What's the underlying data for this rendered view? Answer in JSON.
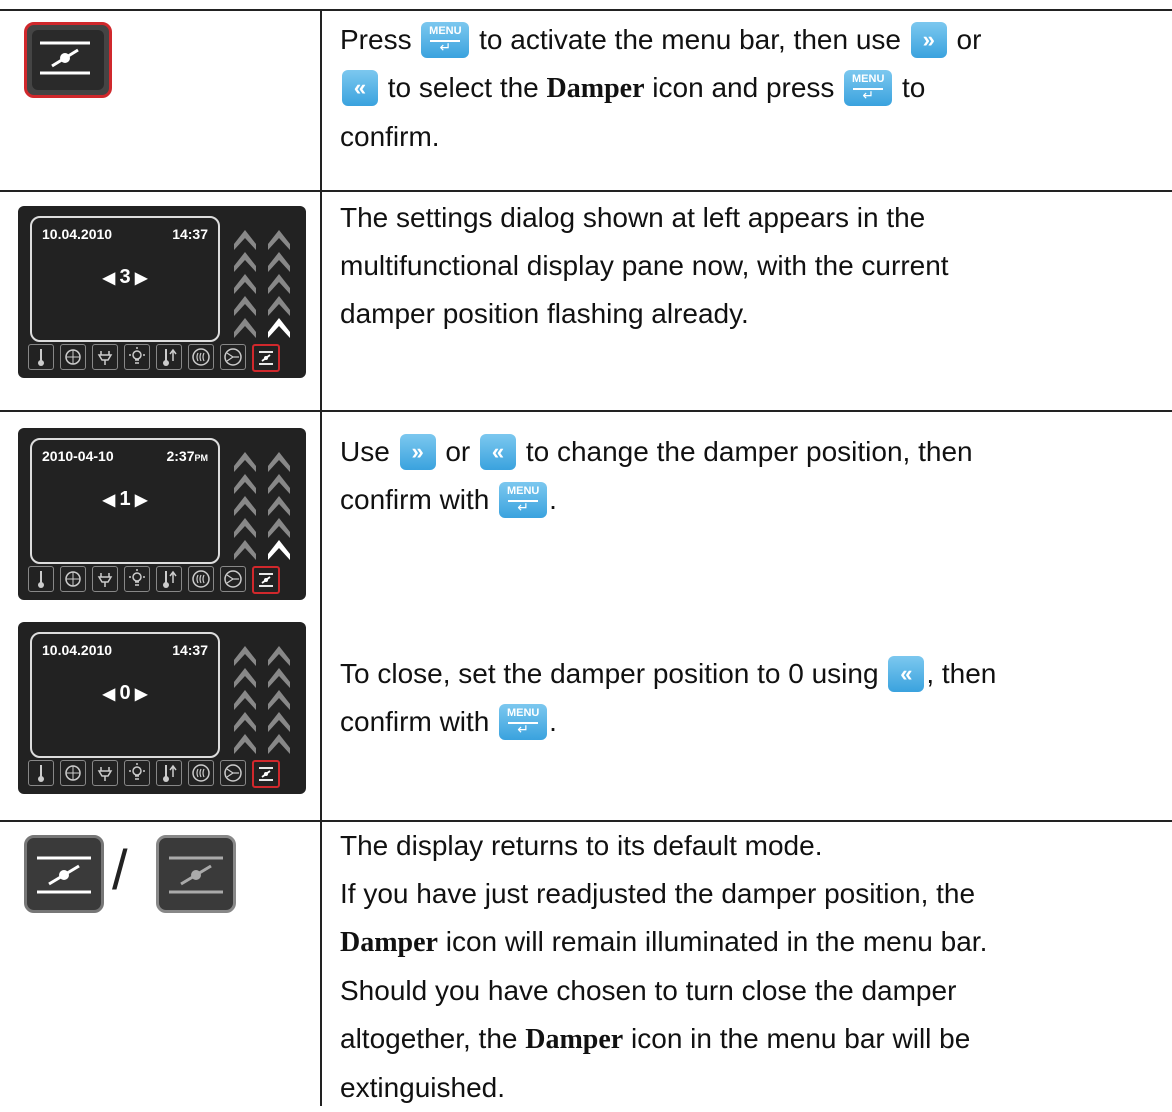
{
  "rows": [
    {
      "text_lines": [
        [
          "Press ",
          "{MENU}",
          " to activate the menu bar, then use ",
          "{RIGHT}",
          " or"
        ],
        [
          "{LEFT}",
          " to select the ",
          "{DAMPER}",
          " icon and press ",
          "{MENU}",
          " to"
        ],
        [
          "confirm."
        ]
      ]
    },
    {
      "display": {
        "date": "10.04.2010",
        "time": "14:37",
        "value": "3"
      },
      "text_lines": [
        [
          "The settings dialog shown at left appears in the"
        ],
        [
          "multifunctional display pane now, with the current"
        ],
        [
          "damper position flashing already."
        ]
      ]
    },
    {
      "display": {
        "date": "2010-04-10",
        "time": "2:37",
        "time_suffix": "PM",
        "value": "1"
      },
      "text_lines": [
        [
          "Use ",
          "{RIGHT}",
          " or ",
          "{LEFT}",
          " to change the damper position, then"
        ],
        [
          "confirm with ",
          "{MENU}",
          "."
        ]
      ]
    },
    {
      "display": {
        "date": "10.04.2010",
        "time": "14:37",
        "value": "0"
      },
      "text_lines": [
        [
          "To close, set the damper position to 0 using ",
          "{LEFT}",
          ", then"
        ],
        [
          "confirm with ",
          "{MENU}",
          "."
        ]
      ]
    },
    {
      "separator": "/",
      "text_lines": [
        [
          "The display returns to its default mode."
        ],
        [
          "If you have just readjusted the damper position, the"
        ],
        [
          "{DAMPER}",
          " icon will remain illuminated in the menu bar."
        ],
        [
          "Should you have chosen to turn close the damper"
        ],
        [
          "altogether, the ",
          "{DAMPER}",
          " icon in the menu bar will be"
        ],
        [
          "extinguished."
        ]
      ]
    }
  ],
  "labels": {
    "menu_button": "MENU",
    "damper_word": "Damper"
  },
  "icons": {
    "right_button": "double-chevron-right-icon",
    "left_button": "double-chevron-left-icon",
    "menu_button": "menu-enter-icon",
    "damper": "damper-icon"
  },
  "colors": {
    "button_blue": "#3aa2de",
    "active_red": "#d0282c",
    "panel_dark": "#222222"
  }
}
